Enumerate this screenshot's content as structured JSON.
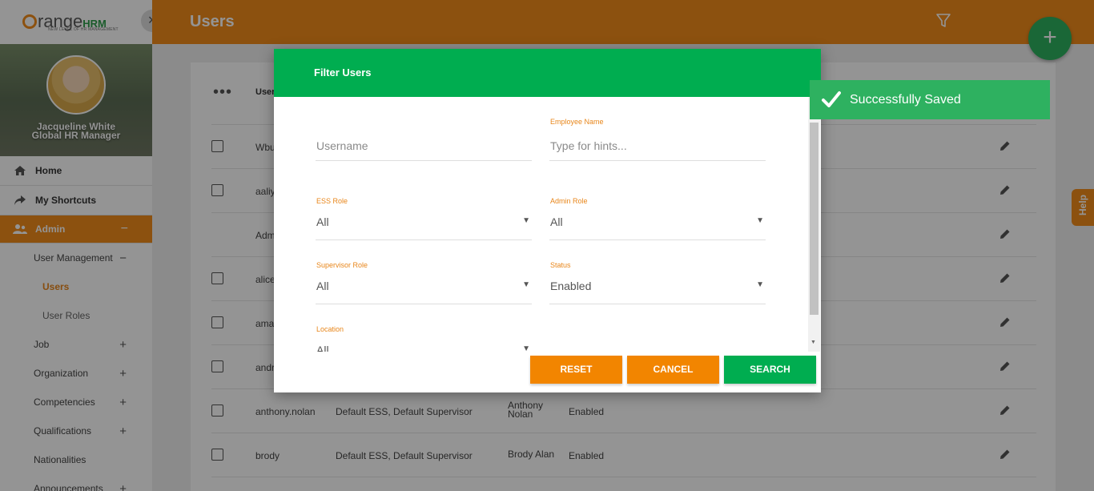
{
  "brand": {
    "name_prefix": "range",
    "name_suffix": "HRM",
    "tagline": "NEW LEVEL OF HR MANAGEMENT",
    "close_glyph": "×"
  },
  "profile": {
    "name": "Jacqueline White",
    "title": "Global HR Manager"
  },
  "sidebar": {
    "items": [
      {
        "label": "Home",
        "icon": "home-icon"
      },
      {
        "label": "My Shortcuts",
        "icon": "share-icon"
      },
      {
        "label": "Admin",
        "icon": "users-icon",
        "state": "−"
      }
    ],
    "admin_sub": [
      {
        "label": "User Management",
        "state": "−"
      },
      {
        "label": "Users"
      },
      {
        "label": "User Roles"
      },
      {
        "label": "Job",
        "state": "+"
      },
      {
        "label": "Organization",
        "state": "+"
      },
      {
        "label": "Competencies",
        "state": "+"
      },
      {
        "label": "Qualifications",
        "state": "+"
      },
      {
        "label": "Nationalities"
      },
      {
        "label": "Announcements",
        "state": "+"
      }
    ]
  },
  "header": {
    "title": "Users",
    "fab_glyph": "+"
  },
  "table": {
    "dots": "•••",
    "user_header": "User",
    "rows": [
      {
        "user": "Wbu",
        "role": "",
        "emp": "",
        "status": "",
        "checkbox": true
      },
      {
        "user": "aaliy",
        "role": "",
        "emp": "",
        "status": "",
        "checkbox": true
      },
      {
        "user": "Adm",
        "role": "",
        "emp": "",
        "status": "",
        "checkbox": false
      },
      {
        "user": "alice",
        "role": "",
        "emp": "",
        "status": "",
        "checkbox": true
      },
      {
        "user": "ama",
        "role": "",
        "emp": "",
        "status": "",
        "checkbox": true
      },
      {
        "user": "andr",
        "role": "",
        "emp": "",
        "status": "",
        "checkbox": true
      },
      {
        "user": "anthony.nolan",
        "role": "Default ESS, Default Supervisor",
        "emp_line1": "Anthony",
        "emp_line2": "Nolan",
        "status": "Enabled",
        "checkbox": true
      },
      {
        "user": "brody",
        "role": "Default ESS, Default Supervisor",
        "emp": "Brody Alan",
        "status": "Enabled",
        "checkbox": true
      }
    ]
  },
  "modal": {
    "title": "Filter Users",
    "username": {
      "placeholder": "Username"
    },
    "employee_name": {
      "label": "Employee Name",
      "placeholder": "Type for hints..."
    },
    "ess_role": {
      "label": "ESS Role",
      "value": "All"
    },
    "admin_role": {
      "label": "Admin Role",
      "value": "All"
    },
    "supervisor_role": {
      "label": "Supervisor Role",
      "value": "All"
    },
    "status": {
      "label": "Status",
      "value": "Enabled"
    },
    "location": {
      "label": "Location",
      "value": "All"
    },
    "buttons": {
      "reset": "RESET",
      "cancel": "CANCEL",
      "search": "SEARCH"
    }
  },
  "toast": {
    "message": "Successfully Saved"
  },
  "help": {
    "label": "Help"
  },
  "colors": {
    "brand_orange": "#f28c1b",
    "brand_green": "#00ad50",
    "toast_green": "#2eb160"
  }
}
